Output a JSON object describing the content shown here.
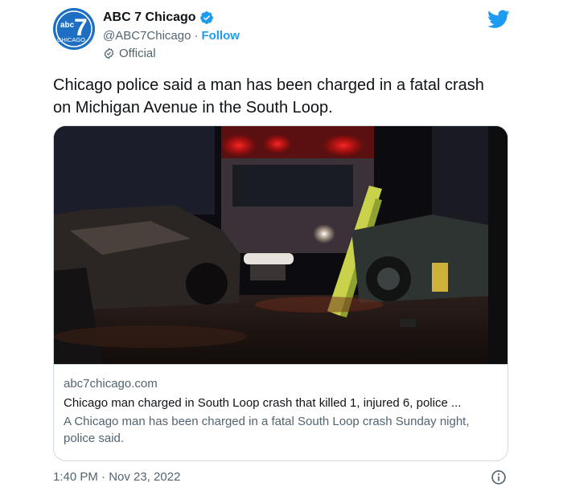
{
  "author": {
    "display_name": "ABC 7 Chicago",
    "handle": "@ABC7Chicago",
    "separator": "·",
    "follow_label": "Follow",
    "label": "Official",
    "avatar_text_top": "abc",
    "avatar_text_mid": "7",
    "avatar_text_bottom": "CHICAGO"
  },
  "tweet": {
    "text": "Chicago police said a man has been charged in a fatal crash on Michigan Avenue in the South Loop.",
    "timestamp": "1:40 PM · Nov 23, 2022"
  },
  "link_card": {
    "domain": "abc7chicago.com",
    "title": "Chicago man charged in South Loop crash that killed 1, injured 6, police ...",
    "description": "A Chicago man has been charged in a fatal South Loop crash Sunday night, police said."
  },
  "icons": {
    "verified": "verified-badge-icon",
    "official": "official-check-icon",
    "platform": "twitter-bird-icon",
    "info": "info-icon"
  },
  "colors": {
    "accent": "#1d9bf0",
    "avatar_bg": "#1e6fc4",
    "text_primary": "#0f1419",
    "text_secondary": "#536471",
    "border": "#cfd9de"
  }
}
